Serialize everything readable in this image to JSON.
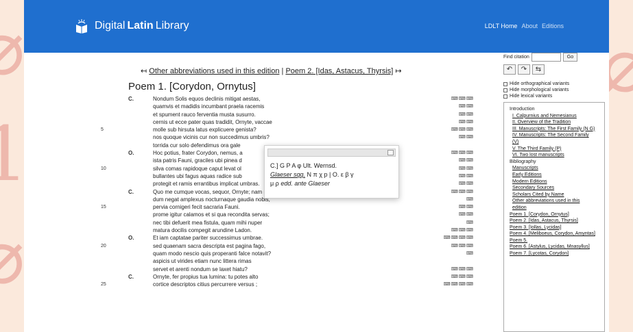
{
  "header": {
    "brand": {
      "prefix": "Digital",
      "bold": "Latin",
      "suffix": "Library"
    },
    "nav": [
      "LDLT Home",
      "About",
      "Editions"
    ]
  },
  "links": {
    "prev": "Other abbreviations used in this edition",
    "sep": "|",
    "next": "Poem 2. [Idas, Astacus, Thyrsis]",
    "prev_arrow": "↤",
    "next_arrow": "↦"
  },
  "poem": {
    "title": "Poem 1. [Corydon, Ornytus]",
    "lines": [
      {
        "num": "",
        "wit": "C.",
        "text": "Nondum Solis equos declinis mitigat aestas,",
        "marks": "⌨⌨⌨"
      },
      {
        "num": "",
        "wit": "",
        "text": "quamvis et madidis incumbant praela racemis",
        "marks": "⌨⌨"
      },
      {
        "num": "",
        "wit": "",
        "text": "et spument rauco ferventia musta susurro.",
        "marks": "⌨⌨"
      },
      {
        "num": "",
        "wit": "",
        "text": "cernis ut ecce pater quas tradidit, Ornyte, vaccae",
        "marks": "⌨⌨"
      },
      {
        "num": "5",
        "wit": "",
        "text": "molle sub hirsuta latus explicuere genista?",
        "marks": "⌨⌨⌨"
      },
      {
        "num": "",
        "wit": "",
        "text": "nos quoque vicinis cur non succedimus umbris?",
        "marks": "⌨⌨"
      },
      {
        "num": "",
        "wit": "",
        "text": "torrida cur solo defendimus ora gale",
        "marks": ""
      },
      {
        "num": "",
        "wit": "O.",
        "text": "Hoc potius, frater Corydon, nemus, a",
        "marks": "⌨⌨⌨"
      },
      {
        "num": "",
        "wit": "",
        "text": "ista patris Fauni, graciles ubi pinea d",
        "marks": "⌨⌨"
      },
      {
        "num": "10",
        "wit": "",
        "text": "silva comas rapidoque caput levat ol",
        "marks": "⌨⌨"
      },
      {
        "num": "",
        "wit": "",
        "text": "bullantes ubi fagus aquas radice sub",
        "marks": "⌨⌨"
      },
      {
        "num": "",
        "wit": "",
        "text": "protegit et ramis errantibus implicat umbras.",
        "marks": "⌨⌨"
      },
      {
        "num": "",
        "wit": "C.",
        "text": "Quo me cumque vocas, sequor, Ornyte; nam mea Leuce,",
        "marks": "⌨⌨⌨"
      },
      {
        "num": "",
        "wit": "",
        "text": "dum negat amplexus nocturnaque gaudia nobis,",
        "marks": "⌨"
      },
      {
        "num": "15",
        "wit": "",
        "text": "pervia cornigeri fecit sacraria Fauni.",
        "marks": "⌨⌨"
      },
      {
        "num": "",
        "wit": "",
        "text": "prome igitur calamos et si qua recondita servas;",
        "marks": "⌨⌨"
      },
      {
        "num": "",
        "wit": "",
        "text": "nec tibi defuerit mea fistula, quam mihi nuper",
        "marks": "⌨"
      },
      {
        "num": "",
        "wit": "",
        "text": "matura docilis compegit arundine Ladon.",
        "marks": "⌨⌨⌨"
      },
      {
        "num": "",
        "wit": "O.",
        "text": "Et iam captatae pariter successimus umbrae.",
        "marks": "⌨⌨⌨⌨"
      },
      {
        "num": "20",
        "wit": "",
        "text": "sed quaenam sacra descripta est pagina fago,",
        "marks": "⌨⌨⌨"
      },
      {
        "num": "",
        "wit": "",
        "text": "quam modo nescio quis properanti falce notavit?",
        "marks": "⌨"
      },
      {
        "num": "",
        "wit": "",
        "text": "aspicis ut virides etiam nunc littera rimas",
        "marks": ""
      },
      {
        "num": "",
        "wit": "",
        "text": "servet et arenti nondum se laxet hiatu?",
        "marks": "⌨⌨⌨"
      },
      {
        "num": "",
        "wit": "C.",
        "text": "Ornyte, fer propius tua lumina: tu potes alto",
        "marks": "⌨⌨⌨"
      },
      {
        "num": "25",
        "wit": "",
        "text": "cortice descriptos citius percurrere versus ;",
        "marks": "⌨⌨⌨⌨"
      }
    ]
  },
  "popup": {
    "line1": "C.] G P A φ Ult. Wernsd.",
    "line2_italic": "Glaeser sqq.",
    "line2_rest": "N π χ p | O. ε β γ",
    "line3_plain": "μ ρ",
    "line3_italic": "edd. ante Glaeser"
  },
  "sidebar": {
    "find_label": "Find citation",
    "go_label": "Go",
    "arrow_back": "↶",
    "arrow_fwd": "↷",
    "arrow_both": "⇆",
    "checks": [
      "Hide orthographical variants",
      "Hide morphological variants",
      "Hide lexical variants"
    ],
    "toc": [
      {
        "kind": "head",
        "text": "Introduction"
      },
      {
        "kind": "sub",
        "text": "I. Calpurnius and Nemesianus"
      },
      {
        "kind": "sub",
        "text": "II. Overview of the Tradition"
      },
      {
        "kind": "sub",
        "text": "III. Manuscripts: The First Family (N G)"
      },
      {
        "kind": "sub",
        "text": "IV. Manuscripts: The Second Family"
      },
      {
        "kind": "sub",
        "text": "(V)"
      },
      {
        "kind": "sub",
        "text": "V. The Third Family (P)"
      },
      {
        "kind": "sub",
        "text": "VI. Two lost manuscripts"
      },
      {
        "kind": "head",
        "text": "Bibliography"
      },
      {
        "kind": "sub",
        "text": "Manuscripts"
      },
      {
        "kind": "sub",
        "text": "Early Editions"
      },
      {
        "kind": "sub",
        "text": "Modern Editions"
      },
      {
        "kind": "sub",
        "text": "Secondary Sources"
      },
      {
        "kind": "sub",
        "text": "Scholars Cited by Name"
      },
      {
        "kind": "sub",
        "text": "Other abbreviations used in this"
      },
      {
        "kind": "sub",
        "text": "edition"
      },
      {
        "kind": "top",
        "text": "Poem 1. [Corydon, Ornytus]"
      },
      {
        "kind": "top",
        "text": "Poem 2. [Idas, Astacus, Thyrsis]"
      },
      {
        "kind": "top",
        "text": "Poem 3. [Iollas, Lycidas]"
      },
      {
        "kind": "top",
        "text": "Poem 4. [Meliboeus, Corydon, Amyntas]"
      },
      {
        "kind": "top",
        "text": "Poem 5."
      },
      {
        "kind": "top",
        "text": "Poem 6. [Astylus, Lycidas, Mnasyllus]"
      },
      {
        "kind": "top",
        "text": "Poem 7. [Lycotas, Corydon]"
      }
    ]
  },
  "colors": {
    "navbar": "#1f6fcf",
    "background": "#fbe9dc",
    "decor": "#eeb8ad"
  }
}
